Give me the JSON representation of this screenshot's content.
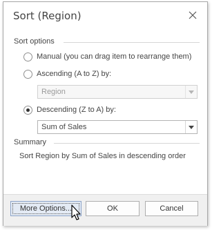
{
  "dialog": {
    "title": "Sort (Region)",
    "close_icon": "close-icon"
  },
  "sort_options": {
    "heading": "Sort options",
    "manual": {
      "label": "Manual (you can drag item to rearrange them)",
      "checked": false
    },
    "ascending": {
      "label": "Ascending (A to Z) by:",
      "checked": false,
      "combo_value": "Region",
      "combo_enabled": false
    },
    "descending": {
      "label": "Descending (Z to A) by:",
      "checked": true,
      "combo_value": "Sum of Sales",
      "combo_enabled": true
    }
  },
  "summary": {
    "heading": "Summary",
    "text": "Sort Region by Sum of Sales in descending order"
  },
  "buttons": {
    "more_options": "More Options...",
    "ok": "OK",
    "cancel": "Cancel"
  }
}
